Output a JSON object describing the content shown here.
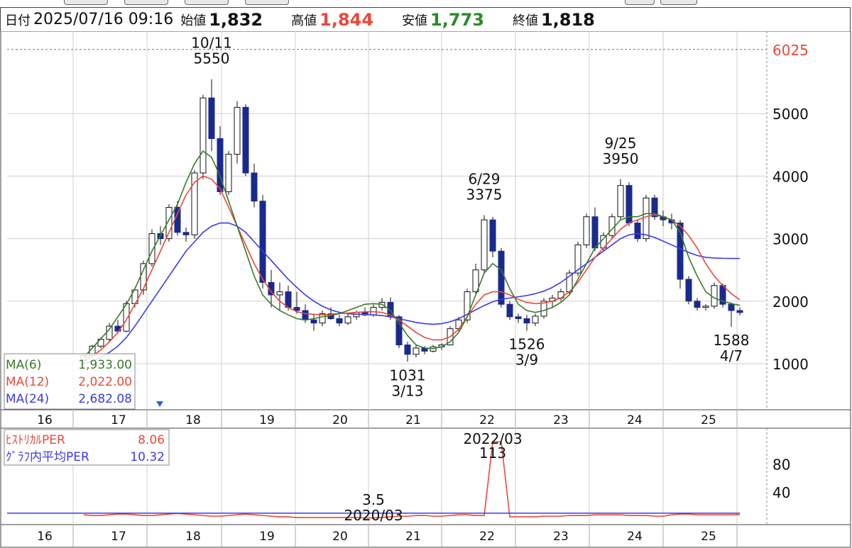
{
  "header": {
    "date_label": "日付",
    "date_value": "2025/07/16 09:16",
    "open_label": "始値",
    "open_value": "1,832",
    "high_label": "高値",
    "high_value": "1,844",
    "low_label": "安値",
    "low_value": "1,773",
    "close_label": "終値",
    "close_value": "1,818"
  },
  "colors": {
    "up_candle": "#ffffff",
    "down_candle": "#1a2a8c",
    "ma6": "#3a7a2a",
    "ma12": "#e8493b",
    "ma24": "#3a3af0",
    "per_line": "#e8493b",
    "per_avg": "#3a3af0",
    "grid": "#cfcfcf",
    "max_line": "#e8493b"
  },
  "legend": {
    "ma6_label": "MA(6)",
    "ma6_value": "1,933.00",
    "ma12_label": "MA(12)",
    "ma12_value": "2,022.00",
    "ma24_label": "MA(24)",
    "ma24_value": "2,682.08",
    "per_label": "ﾋｽﾄﾘｶﾙPER",
    "per_value": "8.06",
    "per_avg_label": "ｸﾞﾗﾌ内平均PER",
    "per_avg_value": "10.32"
  },
  "chart_data": [
    {
      "type": "candlestick",
      "title": "",
      "x_axis": {
        "type": "year",
        "tick_labels": [
          "16",
          "17",
          "18",
          "19",
          "20",
          "21",
          "22",
          "23",
          "24",
          "25"
        ]
      },
      "ylim": [
        0,
        6025
      ],
      "yticks": [
        1000,
        2000,
        3000,
        4000,
        5000
      ],
      "y_max_label": "6025",
      "grid": true,
      "month_interval": 1,
      "start_period": "2016/03",
      "candles": [
        [
          1050,
          1150,
          980,
          1130
        ],
        [
          1130,
          1300,
          1100,
          1280
        ],
        [
          1280,
          1420,
          1250,
          1390
        ],
        [
          1390,
          1650,
          1350,
          1600
        ],
        [
          1600,
          1700,
          1480,
          1520
        ],
        [
          1520,
          2000,
          1500,
          1960
        ],
        [
          1960,
          2220,
          1900,
          2180
        ],
        [
          2180,
          2650,
          2100,
          2600
        ],
        [
          2600,
          3150,
          2550,
          3080
        ],
        [
          3080,
          3200,
          2900,
          3000
        ],
        [
          3000,
          3550,
          2950,
          3500
        ],
        [
          3500,
          3600,
          3050,
          3100
        ],
        [
          3100,
          3180,
          2950,
          3060
        ],
        [
          3060,
          4100,
          3000,
          4050
        ],
        [
          4050,
          5300,
          3950,
          5250
        ],
        [
          5250,
          5550,
          4400,
          4600
        ],
        [
          4600,
          4800,
          3700,
          3750
        ],
        [
          3750,
          4400,
          3700,
          4350
        ],
        [
          4350,
          5200,
          4200,
          5100
        ],
        [
          5100,
          5150,
          4000,
          4050
        ],
        [
          4050,
          4200,
          3500,
          3600
        ],
        [
          3600,
          3700,
          2200,
          2300
        ],
        [
          2300,
          2500,
          1900,
          2100
        ],
        [
          2100,
          2300,
          1850,
          2150
        ],
        [
          2150,
          2250,
          1850,
          1900
        ],
        [
          1900,
          2150,
          1800,
          1850
        ],
        [
          1850,
          1950,
          1650,
          1700
        ],
        [
          1700,
          1800,
          1526,
          1650
        ],
        [
          1650,
          1850,
          1600,
          1800
        ],
        [
          1800,
          1900,
          1700,
          1720
        ],
        [
          1720,
          1780,
          1600,
          1650
        ],
        [
          1650,
          1800,
          1620,
          1750
        ],
        [
          1750,
          1850,
          1700,
          1820
        ],
        [
          1820,
          1900,
          1760,
          1780
        ],
        [
          1780,
          1950,
          1750,
          1900
        ],
        [
          1900,
          2050,
          1850,
          1980
        ],
        [
          1980,
          2060,
          1700,
          1750
        ],
        [
          1750,
          1780,
          1250,
          1300
        ],
        [
          1300,
          1350,
          1031,
          1150
        ],
        [
          1150,
          1300,
          1100,
          1250
        ],
        [
          1250,
          1280,
          1150,
          1200
        ],
        [
          1200,
          1300,
          1180,
          1270
        ],
        [
          1270,
          1330,
          1220,
          1300
        ],
        [
          1300,
          1600,
          1290,
          1560
        ],
        [
          1560,
          1750,
          1520,
          1700
        ],
        [
          1700,
          2200,
          1650,
          2150
        ],
        [
          2150,
          2600,
          2100,
          2500
        ],
        [
          2500,
          3375,
          2450,
          3300
        ],
        [
          3300,
          3350,
          2700,
          2800
        ],
        [
          2800,
          2850,
          1900,
          1950
        ],
        [
          1950,
          2000,
          1700,
          1750
        ],
        [
          1750,
          1800,
          1650,
          1720
        ],
        [
          1720,
          1780,
          1526,
          1650
        ],
        [
          1650,
          1800,
          1600,
          1760
        ],
        [
          1760,
          2050,
          1720,
          2000
        ],
        [
          2000,
          2100,
          1900,
          2050
        ],
        [
          2050,
          2200,
          2000,
          2150
        ],
        [
          2150,
          2500,
          2100,
          2450
        ],
        [
          2450,
          2950,
          2400,
          2900
        ],
        [
          2900,
          3400,
          2850,
          3350
        ],
        [
          3350,
          3500,
          2800,
          2850
        ],
        [
          2850,
          3100,
          2800,
          3050
        ],
        [
          3050,
          3400,
          3000,
          3350
        ],
        [
          3350,
          3950,
          3300,
          3850
        ],
        [
          3850,
          3900,
          3200,
          3250
        ],
        [
          3250,
          3300,
          2950,
          3000
        ],
        [
          3000,
          3700,
          2950,
          3650
        ],
        [
          3650,
          3700,
          3300,
          3350
        ],
        [
          3350,
          3450,
          3200,
          3300
        ],
        [
          3300,
          3400,
          3150,
          3250
        ],
        [
          3250,
          3300,
          2200,
          2350
        ],
        [
          2350,
          2400,
          1950,
          2000
        ],
        [
          2000,
          2050,
          1850,
          1900
        ],
        [
          1900,
          1950,
          1850,
          1920
        ],
        [
          1920,
          2300,
          1880,
          2250
        ],
        [
          2250,
          2280,
          1900,
          1950
        ],
        [
          1950,
          1980,
          1588,
          1850
        ],
        [
          1850,
          1900,
          1773,
          1818
        ]
      ],
      "ma6_values": [
        1100,
        1250,
        1400,
        1550,
        1750,
        1950,
        2200,
        2500,
        2800,
        3050,
        3300,
        3550,
        3900,
        4200,
        4400,
        4300,
        4000,
        3600,
        3200,
        2800,
        2400,
        2100,
        1950,
        1850,
        1780,
        1720,
        1700,
        1720,
        1750,
        1770,
        1800,
        1850,
        1900,
        1950,
        1960,
        1950,
        1850,
        1650,
        1450,
        1300,
        1250,
        1240,
        1270,
        1350,
        1500,
        1750,
        2100,
        2450,
        2600,
        2500,
        2200,
        1950,
        1850,
        1820,
        1850,
        1900,
        1980,
        2100,
        2350,
        2600,
        2850,
        3000,
        3150,
        3300,
        3350,
        3350,
        3400,
        3400,
        3350,
        3300,
        3100,
        2700,
        2400,
        2150,
        2050,
        2000,
        1960,
        1933
      ],
      "ma12_values": [
        1050,
        1120,
        1220,
        1350,
        1500,
        1700,
        1950,
        2200,
        2500,
        2800,
        3100,
        3400,
        3700,
        3900,
        4000,
        3950,
        3800,
        3500,
        3200,
        2900,
        2600,
        2350,
        2150,
        2000,
        1900,
        1830,
        1800,
        1790,
        1780,
        1790,
        1800,
        1810,
        1820,
        1830,
        1830,
        1820,
        1780,
        1700,
        1600,
        1500,
        1420,
        1380,
        1380,
        1430,
        1550,
        1750,
        1950,
        2100,
        2150,
        2150,
        2100,
        2030,
        1980,
        1960,
        1970,
        2000,
        2050,
        2150,
        2300,
        2500,
        2700,
        2850,
        3000,
        3150,
        3250,
        3300,
        3350,
        3380,
        3350,
        3300,
        3200,
        3050,
        2850,
        2600,
        2400,
        2250,
        2120,
        2022
      ],
      "ma24_values": [
        1000,
        1040,
        1100,
        1180,
        1280,
        1420,
        1600,
        1800,
        2000,
        2200,
        2400,
        2600,
        2800,
        2950,
        3100,
        3200,
        3250,
        3250,
        3200,
        3100,
        2950,
        2800,
        2650,
        2500,
        2350,
        2220,
        2100,
        2000,
        1920,
        1860,
        1820,
        1800,
        1790,
        1790,
        1780,
        1770,
        1750,
        1720,
        1690,
        1660,
        1640,
        1630,
        1640,
        1670,
        1720,
        1790,
        1860,
        1930,
        1990,
        2030,
        2050,
        2070,
        2090,
        2120,
        2160,
        2220,
        2300,
        2400,
        2500,
        2600,
        2700,
        2800,
        2900,
        3000,
        3060,
        3080,
        3060,
        3020,
        2960,
        2900,
        2840,
        2780,
        2730,
        2700,
        2690,
        2685,
        2683,
        2682.08
      ],
      "annotations": [
        {
          "date": "10/11",
          "value": "5550",
          "at_index": 15,
          "position": "above"
        },
        {
          "date": "3/13",
          "value": "1031",
          "at_index": 38,
          "position": "below"
        },
        {
          "date": "6/29",
          "value": "3375",
          "at_index": 47,
          "position": "above"
        },
        {
          "date": "3/9",
          "value": "1526",
          "at_index": 52,
          "position": "below"
        },
        {
          "date": "9/25",
          "value": "3950",
          "at_index": 63,
          "position": "above"
        },
        {
          "date": "4/7",
          "value": "1588",
          "at_index": 76,
          "position": "below"
        }
      ]
    },
    {
      "type": "line",
      "title": "",
      "ylim": [
        0,
        120
      ],
      "yticks": [
        40,
        80
      ],
      "x_axis": {
        "type": "year",
        "tick_labels": [
          "16",
          "17",
          "18",
          "19",
          "20",
          "21",
          "22",
          "23",
          "24",
          "25"
        ]
      },
      "series": [
        {
          "values": [
            8,
            7,
            7,
            8,
            9,
            9,
            8,
            7,
            7,
            8,
            9,
            10,
            9,
            8,
            7,
            6,
            6,
            7,
            8,
            9,
            8,
            7,
            6,
            5,
            5,
            4,
            4,
            4,
            4,
            4,
            4,
            4,
            4,
            3.5,
            3.5,
            4,
            5,
            6,
            6,
            7,
            7,
            6,
            6,
            7,
            8,
            8,
            7,
            7,
            113,
            113,
            5,
            5,
            5,
            5,
            6,
            6,
            6,
            7,
            7,
            7,
            8,
            8,
            8,
            8,
            7,
            7,
            7,
            6,
            6,
            8,
            9,
            9,
            8,
            8,
            8,
            8,
            8,
            8.06
          ]
        },
        {
          "values": [
            10.32,
            10.32
          ]
        }
      ],
      "annotations": [
        {
          "date": "2020/03",
          "value": "3.5",
          "at_index": 34,
          "position": "above"
        },
        {
          "date": "2022/03",
          "value": "113",
          "at_index": 48,
          "position": "above"
        }
      ]
    }
  ]
}
